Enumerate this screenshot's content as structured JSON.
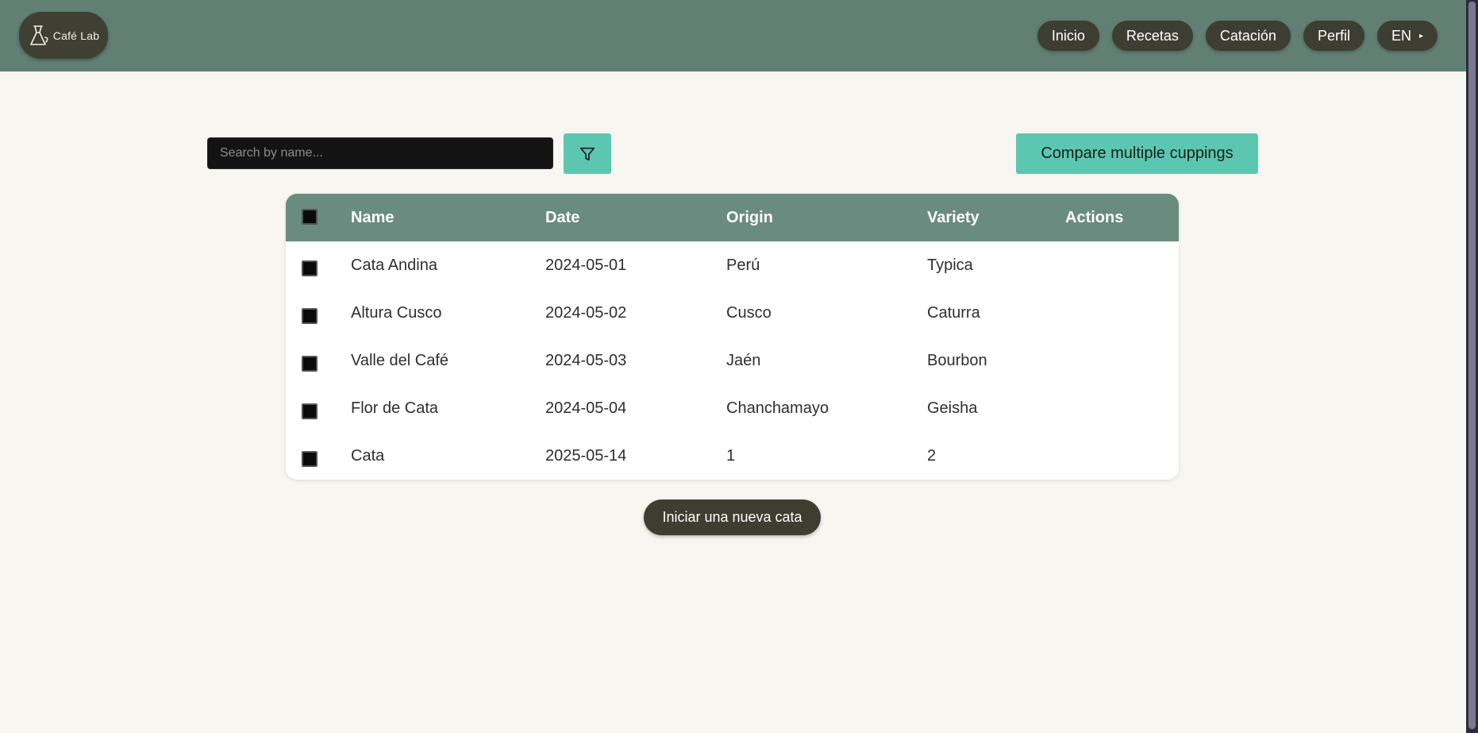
{
  "header": {
    "logo_text": "Café Lab",
    "nav": [
      {
        "label": "Inicio",
        "name": "nav-inicio"
      },
      {
        "label": "Recetas",
        "name": "nav-recetas"
      },
      {
        "label": "Catación",
        "name": "nav-catacion"
      },
      {
        "label": "Perfil",
        "name": "nav-perfil"
      }
    ],
    "language": "EN"
  },
  "toolbar": {
    "search_placeholder": "Search by name...",
    "search_value": "",
    "filter_icon": "filter-icon",
    "compare_label": "Compare multiple cuppings"
  },
  "table": {
    "columns": [
      "Name",
      "Date",
      "Origin",
      "Variety",
      "Actions"
    ],
    "rows": [
      {
        "name": "Cata Andina",
        "date": "2024-05-01",
        "origin": "Perú",
        "variety": "Typica"
      },
      {
        "name": "Altura Cusco",
        "date": "2024-05-02",
        "origin": "Cusco",
        "variety": "Caturra"
      },
      {
        "name": "Valle del Café",
        "date": "2024-05-03",
        "origin": "Jaén",
        "variety": "Bourbon"
      },
      {
        "name": "Flor de Cata",
        "date": "2024-05-04",
        "origin": "Chanchamayo",
        "variety": "Geisha"
      },
      {
        "name": "Cata",
        "date": "2025-05-14",
        "origin": "1",
        "variety": "2"
      }
    ]
  },
  "actions": {
    "new_cupping_label": "Iniciar una nueva cata"
  },
  "colors": {
    "header_bg": "#617f72",
    "page_bg": "#f7f6f1",
    "accent": "#5cc7b0",
    "dark_button": "#3d3d32",
    "table_header": "#6a8b80"
  }
}
